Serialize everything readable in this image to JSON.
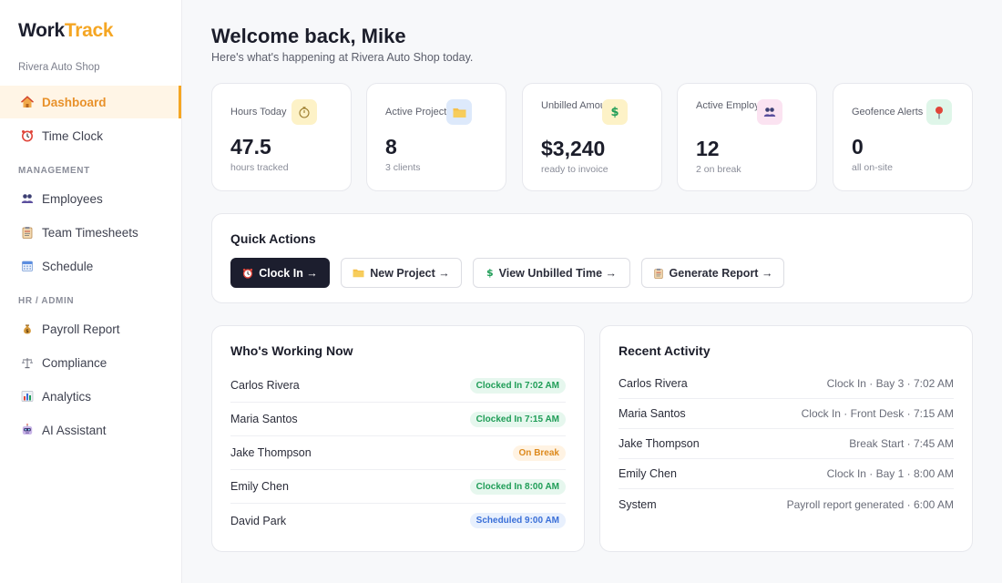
{
  "brand": {
    "name_part1": "Work",
    "name_part2": "Track",
    "shop": "Rivera Auto Shop"
  },
  "sidebar": {
    "items": [
      {
        "label": "Dashboard",
        "icon": "house-icon"
      },
      {
        "label": "Time Clock",
        "icon": "alarm-clock-icon"
      },
      {
        "label": "Employees",
        "icon": "people-icon"
      },
      {
        "label": "Team Timesheets",
        "icon": "clipboard-icon"
      },
      {
        "label": "Schedule",
        "icon": "calendar-icon"
      },
      {
        "label": "Payroll Report",
        "icon": "money-bag-icon"
      },
      {
        "label": "Compliance",
        "icon": "scales-icon"
      },
      {
        "label": "Analytics",
        "icon": "bar-chart-icon"
      },
      {
        "label": "AI Assistant",
        "icon": "robot-icon"
      }
    ],
    "sections": [
      "MANAGEMENT",
      "HR / ADMIN"
    ]
  },
  "header": {
    "title": "Welcome back, Mike",
    "subtitle": "Here's what's happening at Rivera Auto Shop today."
  },
  "stats": [
    {
      "label": "Hours Today",
      "value": "47.5",
      "sub": "hours tracked",
      "icon": "stopwatch-icon",
      "icon_bg": "#fdf2c7"
    },
    {
      "label": "Active Projects",
      "value": "8",
      "sub": "3 clients",
      "icon": "folder-icon",
      "icon_bg": "#dde9fb"
    },
    {
      "label": "Unbilled Amount",
      "value": "$3,240",
      "sub": "ready to invoice",
      "icon": "dollar-icon",
      "icon_bg": "#fdf2c7"
    },
    {
      "label": "Active Employees",
      "value": "12",
      "sub": "2 on break",
      "icon": "people-icon",
      "icon_bg": "#fbe3f1"
    },
    {
      "label": "Geofence Alerts",
      "value": "0",
      "sub": "all on-site",
      "icon": "pushpin-icon",
      "icon_bg": "#dff6e9"
    }
  ],
  "quick_actions": {
    "title": "Quick Actions",
    "buttons": [
      {
        "label": "Clock In →",
        "icon": "alarm-clock-icon"
      },
      {
        "label": "New Project →",
        "icon": "folder-icon"
      },
      {
        "label": "View Unbilled Time →",
        "icon": "dollar-icon"
      },
      {
        "label": "Generate Report →",
        "icon": "clipboard-icon"
      }
    ]
  },
  "working_now": {
    "title": "Who's Working Now",
    "rows": [
      {
        "name": "Carlos Rivera",
        "status": "Clocked In 7:02 AM"
      },
      {
        "name": "Maria Santos",
        "status": "Clocked In 7:15 AM"
      },
      {
        "name": "Jake Thompson",
        "status": "On Break"
      },
      {
        "name": "Emily Chen",
        "status": "Clocked In 8:00 AM"
      },
      {
        "name": "David Park",
        "status": "Scheduled 9:00 AM"
      }
    ]
  },
  "recent_activity": {
    "title": "Recent Activity",
    "rows": [
      {
        "name": "Carlos Rivera",
        "detail": "Clock In · Bay 3 · 7:02 AM"
      },
      {
        "name": "Maria Santos",
        "detail": "Clock In · Front Desk · 7:15 AM"
      },
      {
        "name": "Jake Thompson",
        "detail": "Break Start · 7:45 AM"
      },
      {
        "name": "Emily Chen",
        "detail": "Clock In · Bay 1 · 8:00 AM"
      },
      {
        "name": "System",
        "detail": "Payroll report generated · 6:00 AM"
      }
    ]
  },
  "colors": {
    "accent": "#f5a623",
    "dark": "#1c1e2e",
    "green": "#1f9d57",
    "orange": "#dd8a1e",
    "blue": "#3a6fd8"
  }
}
